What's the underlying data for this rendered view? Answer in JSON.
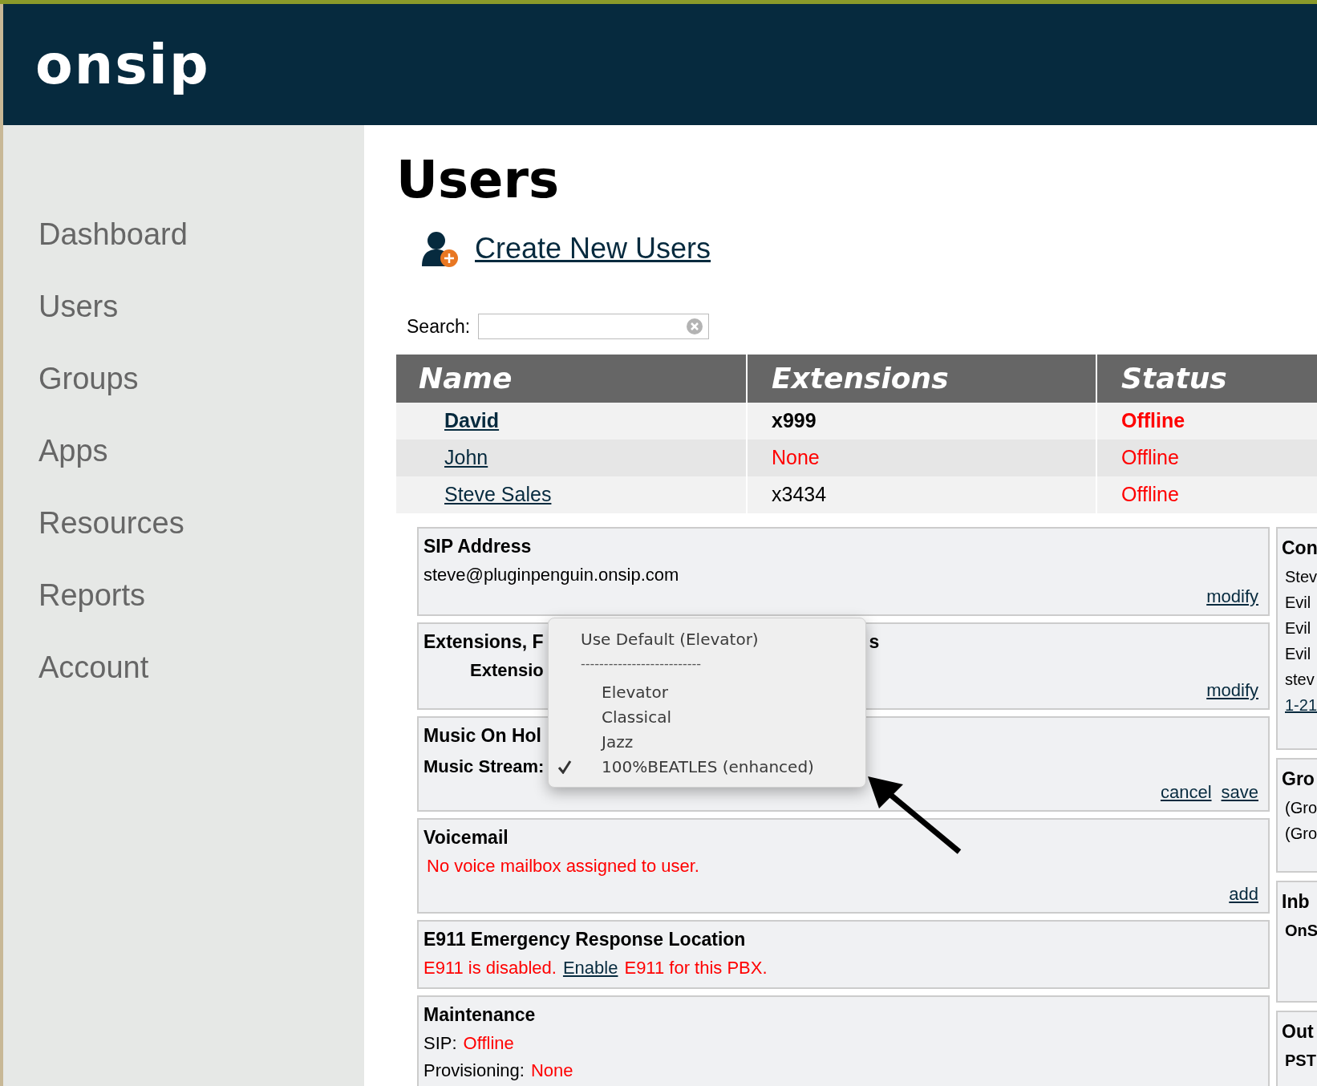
{
  "header": {
    "logo": "onsip"
  },
  "sidebar": {
    "items": [
      {
        "label": "Dashboard"
      },
      {
        "label": "Users"
      },
      {
        "label": "Groups"
      },
      {
        "label": "Apps"
      },
      {
        "label": "Resources"
      },
      {
        "label": "Reports"
      },
      {
        "label": "Account"
      }
    ]
  },
  "page": {
    "title": "Users",
    "create_link": "Create New Users",
    "search": {
      "label": "Search:"
    }
  },
  "table": {
    "columns": [
      "Name",
      "Extensions",
      "Status"
    ],
    "rows": [
      {
        "name": "David",
        "extension": "x999",
        "extension_missing": false,
        "status": "Offline",
        "highlighted": true
      },
      {
        "name": "John",
        "extension": "None",
        "extension_missing": true,
        "status": "Offline",
        "highlighted": false
      },
      {
        "name": "Steve Sales",
        "extension": "x3434",
        "extension_missing": false,
        "status": "Offline",
        "highlighted": false
      }
    ]
  },
  "panels": [
    {
      "title": "SIP Address",
      "lines": [
        {
          "kind": "plain",
          "segments": [
            {
              "kind": "plain",
              "text": "steve@pluginpenguin.onsip.com"
            }
          ]
        }
      ],
      "actions": [
        "modify"
      ]
    },
    {
      "title": "Extensions, F",
      "title_tail": "s",
      "lines": [
        {
          "kind": "indented_bold",
          "segments": [
            {
              "kind": "plain",
              "text": "Extensio"
            }
          ]
        }
      ],
      "actions": [
        "modify"
      ]
    },
    {
      "title": "Music On Hol",
      "lines": [
        {
          "kind": "bold",
          "segments": [
            {
              "kind": "plain",
              "text": "Music Stream:"
            }
          ]
        }
      ],
      "actions": [
        "cancel",
        "save"
      ]
    },
    {
      "title": "Voicemail",
      "lines": [
        {
          "kind": "plain",
          "segments": [
            {
              "kind": "alert",
              "text": "No voice mailbox assigned to user."
            }
          ]
        }
      ],
      "actions": [
        "add"
      ]
    },
    {
      "title": "E911 Emergency Response Location",
      "lines": [
        {
          "kind": "plain",
          "segments": [
            {
              "kind": "alert",
              "text": "E911 is disabled."
            },
            {
              "kind": "link",
              "text": "Enable"
            },
            {
              "kind": "alert",
              "text": "E911 for this PBX."
            }
          ]
        }
      ]
    },
    {
      "title": "Maintenance",
      "lines": [
        {
          "kind": "plain",
          "segments": [
            {
              "kind": "plain",
              "text": "SIP:"
            },
            {
              "kind": "alert",
              "text": "Offline"
            }
          ]
        },
        {
          "kind": "plain",
          "segments": [
            {
              "kind": "plain",
              "text": "Provisioning:"
            },
            {
              "kind": "alert",
              "text": "None"
            }
          ]
        }
      ]
    }
  ],
  "side_panels": [
    {
      "title": "Con",
      "lines": [
        {
          "kind": "plain",
          "text": "Stev"
        },
        {
          "kind": "plain",
          "text": "Evil"
        },
        {
          "kind": "plain",
          "text": "Evil"
        },
        {
          "kind": "plain",
          "text": "Evil"
        },
        {
          "kind": "plain",
          "text": "stev"
        },
        {
          "kind": "link",
          "text": "1-21"
        }
      ]
    },
    {
      "title": "Gro",
      "lines": [
        {
          "kind": "plain",
          "text": "(Gro"
        },
        {
          "kind": "plain",
          "text": "(Gro"
        }
      ]
    },
    {
      "title": "Inb",
      "lines": [
        {
          "kind": "bold",
          "text": "OnS"
        }
      ]
    },
    {
      "title": "Out",
      "lines": [
        {
          "kind": "bold",
          "text": "PST"
        }
      ]
    }
  ],
  "dropdown": {
    "options": [
      {
        "kind": "default",
        "label": "Use Default (Elevator)",
        "selected": false
      },
      {
        "kind": "separator",
        "label": "--------------------------"
      },
      {
        "kind": "option",
        "label": "Elevator",
        "selected": false
      },
      {
        "kind": "option",
        "label": "Classical",
        "selected": false
      },
      {
        "kind": "option",
        "label": "Jazz",
        "selected": false
      },
      {
        "kind": "option",
        "label": "100%BEATLES (enhanced)",
        "selected": true
      }
    ]
  }
}
